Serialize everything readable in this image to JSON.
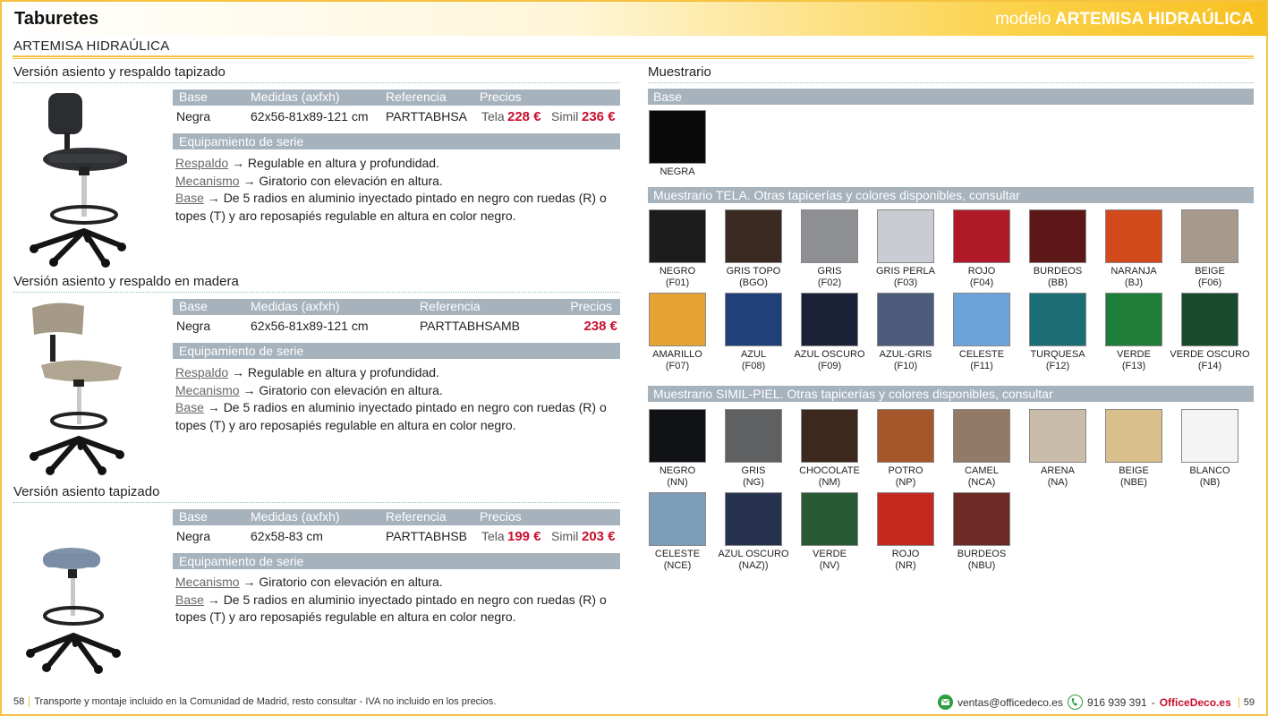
{
  "header": {
    "category": "Taburetes",
    "model_prefix": "modelo",
    "model_name": "ARTEMISA HIDRAÚLICA"
  },
  "subtitle": "ARTEMISA HIDRAÚLICA",
  "columns": {
    "base": "Base",
    "medidas": "Medidas (axfxh)",
    "referencia": "Referencia",
    "precios": "Precios",
    "equipamiento": "Equipamiento de serie"
  },
  "versions": [
    {
      "title": "Versión asiento y respaldo tapizado",
      "base": "Negra",
      "medidas": "62x56-81x89-121 cm",
      "referencia": "PARTTABHSA",
      "tela_label": "Tela",
      "tela_price": "228 €",
      "simil_label": "Simil",
      "simil_price": "236 €",
      "respaldo_k": "Respaldo",
      "respaldo_v": " → Regulable en altura y profundidad.",
      "mecanismo_k": "Mecanismo",
      "mecanismo_v": " → Giratorio con elevación en altura.",
      "base_k": "Base",
      "base_v": " → De 5 radios en aluminio inyectado pintado en negro con ruedas (R) o topes (T) y aro reposapiés regulable en altura en color negro."
    },
    {
      "title": "Versión asiento y respaldo en madera",
      "base": "Negra",
      "medidas": "62x56-81x89-121 cm",
      "referencia": "PARTTABHSAMB",
      "price": "238 €",
      "respaldo_k": "Respaldo",
      "respaldo_v": " → Regulable en altura y profundidad.",
      "mecanismo_k": "Mecanismo",
      "mecanismo_v": " → Giratorio con elevación en altura.",
      "base_k": "Base",
      "base_v": " → De 5 radios en aluminio inyectado pintado en negro con ruedas (R) o topes (T) y aro reposapiés regulable en altura en color negro."
    },
    {
      "title": "Versión asiento tapizado",
      "base": "Negra",
      "medidas": "62x58-83 cm",
      "referencia": "PARTTABHSB",
      "tela_label": "Tela",
      "tela_price": "199 €",
      "simil_label": "Simil",
      "simil_price": "203 €",
      "mecanismo_k": "Mecanismo",
      "mecanismo_v": " → Giratorio con elevación en altura.",
      "base_k": "Base",
      "base_v": " → De 5 radios en aluminio inyectado pintado en negro con ruedas (R) o topes (T) y aro reposapiés regulable en altura en color negro."
    }
  ],
  "muestrario": {
    "title": "Muestrario",
    "base_head": "Base",
    "base_swatches": [
      {
        "name": "NEGRA",
        "color": "#0a0a0a"
      }
    ],
    "tela_head": "Muestrario TELA. Otras tapicerías y colores disponibles, consultar",
    "tela": [
      {
        "name": "NEGRO",
        "code": "(F01)",
        "color": "#1c1c1c"
      },
      {
        "name": "GRIS TOPO",
        "code": "(BGO)",
        "color": "#3a2a22"
      },
      {
        "name": "GRIS",
        "code": "(F02)",
        "color": "#8d8f92"
      },
      {
        "name": "GRIS PERLA",
        "code": "(F03)",
        "color": "#c9ccd2"
      },
      {
        "name": "ROJO",
        "code": "(F04)",
        "color": "#b01a28"
      },
      {
        "name": "BURDEOS",
        "code": "(BB)",
        "color": "#5e1718"
      },
      {
        "name": "NARANJA",
        "code": "(BJ)",
        "color": "#d2491c"
      },
      {
        "name": "BEIGE",
        "code": "(F06)",
        "color": "#a79a8c"
      },
      {
        "name": "AMARILLO",
        "code": "(F07)",
        "color": "#e8a232"
      },
      {
        "name": "AZUL",
        "code": "(F08)",
        "color": "#1f4079"
      },
      {
        "name": "AZUL OSCURO",
        "code": "(F09)",
        "color": "#1b2238"
      },
      {
        "name": "AZUL-GRIS",
        "code": "(F10)",
        "color": "#4c5a7c"
      },
      {
        "name": "CELESTE",
        "code": "(F11)",
        "color": "#6ea3d9"
      },
      {
        "name": "TURQUESA",
        "code": "(F12)",
        "color": "#1b6e73"
      },
      {
        "name": "VERDE",
        "code": "(F13)",
        "color": "#1f7d3a"
      },
      {
        "name": "VERDE OSCURO",
        "code": "(F14)",
        "color": "#174b2c"
      }
    ],
    "simil_head": "Muestrario SIMIL-PIEL. Otras tapicerías y colores disponibles, consultar",
    "simil": [
      {
        "name": "NEGRO",
        "code": "(NN)",
        "color": "#101216"
      },
      {
        "name": "GRIS",
        "code": "(NG)",
        "color": "#5e6062"
      },
      {
        "name": "CHOCOLATE",
        "code": "(NM)",
        "color": "#3d281d"
      },
      {
        "name": "POTRO",
        "code": "(NP)",
        "color": "#a5562a"
      },
      {
        "name": "CAMEL",
        "code": "(NCA)",
        "color": "#927a66"
      },
      {
        "name": "ARENA",
        "code": "(NA)",
        "color": "#c9bcab"
      },
      {
        "name": "BEIGE",
        "code": "(NBE)",
        "color": "#d8bf8c"
      },
      {
        "name": "BLANCO",
        "code": "(NB)",
        "color": "#f4f4f4"
      },
      {
        "name": "CELESTE",
        "code": "(NCE)",
        "color": "#7d9cb8"
      },
      {
        "name": "AZUL OSCURO",
        "code": "(NAZ))",
        "color": "#26324f"
      },
      {
        "name": "VERDE",
        "code": "(NV)",
        "color": "#285b33"
      },
      {
        "name": "ROJO",
        "code": "(NR)",
        "color": "#c4281e"
      },
      {
        "name": "BURDEOS",
        "code": "(NBU)",
        "color": "#6c2a25"
      }
    ]
  },
  "footer": {
    "page_left": "58",
    "note": "Transporte y montaje incluido en la Comunidad de Madrid, resto consultar - IVA no incluido en los precios.",
    "email": "ventas@officedeco.es",
    "phone": "916 939 391",
    "sep": "-",
    "brand": "OfficeDeco.es",
    "page_right": "59"
  },
  "colors": {
    "accent": "#f5c242",
    "price": "#c8102e",
    "table_head": "#a6b2bc"
  }
}
